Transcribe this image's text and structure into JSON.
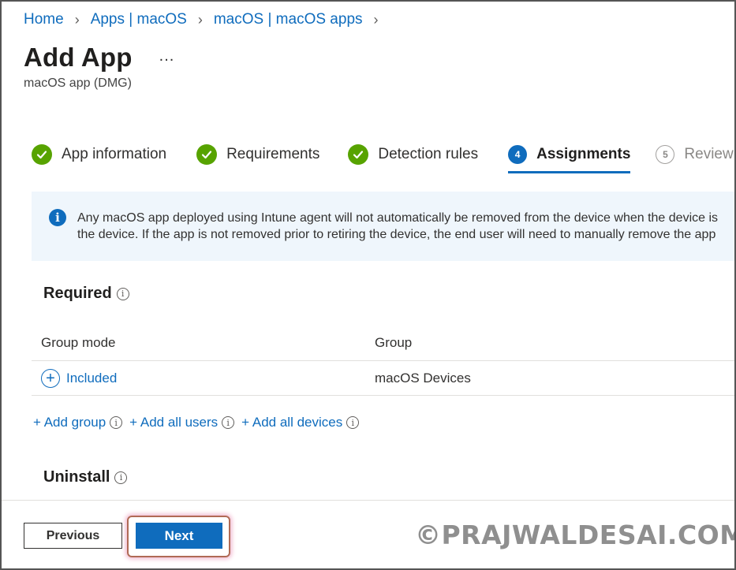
{
  "breadcrumb": [
    "Home",
    "Apps | macOS",
    "macOS | macOS apps"
  ],
  "page": {
    "title": "Add App",
    "more": "...",
    "subtitle": "macOS app (DMG)"
  },
  "steps": [
    {
      "label": "App information",
      "state": "complete"
    },
    {
      "label": "Requirements",
      "state": "complete"
    },
    {
      "label": "Detection rules",
      "state": "complete"
    },
    {
      "number": "4",
      "label": "Assignments",
      "state": "active"
    },
    {
      "number": "5",
      "label": "Review",
      "state": "future"
    }
  ],
  "banner": {
    "icon": "info-icon",
    "line1": "Any macOS app deployed using Intune agent will not automatically be removed from the device when the device is",
    "line2": "the device. If the app is not removed prior to retiring the device, the end user will need to manually remove the app"
  },
  "required": {
    "title": "Required",
    "columns": [
      "Group mode",
      "Group"
    ],
    "rows": [
      {
        "mode": "Included",
        "group": "macOS Devices"
      }
    ],
    "links": [
      "+ Add group",
      "+ Add all users",
      "+ Add all devices"
    ]
  },
  "uninstall": {
    "title": "Uninstall"
  },
  "buttons": {
    "previous": "Previous",
    "next": "Next"
  },
  "watermark": "©PRAJWALDESAI.COM",
  "colors": {
    "accent": "#0f6cbd",
    "success": "#57a300",
    "banner_bg": "#eff6fc"
  }
}
